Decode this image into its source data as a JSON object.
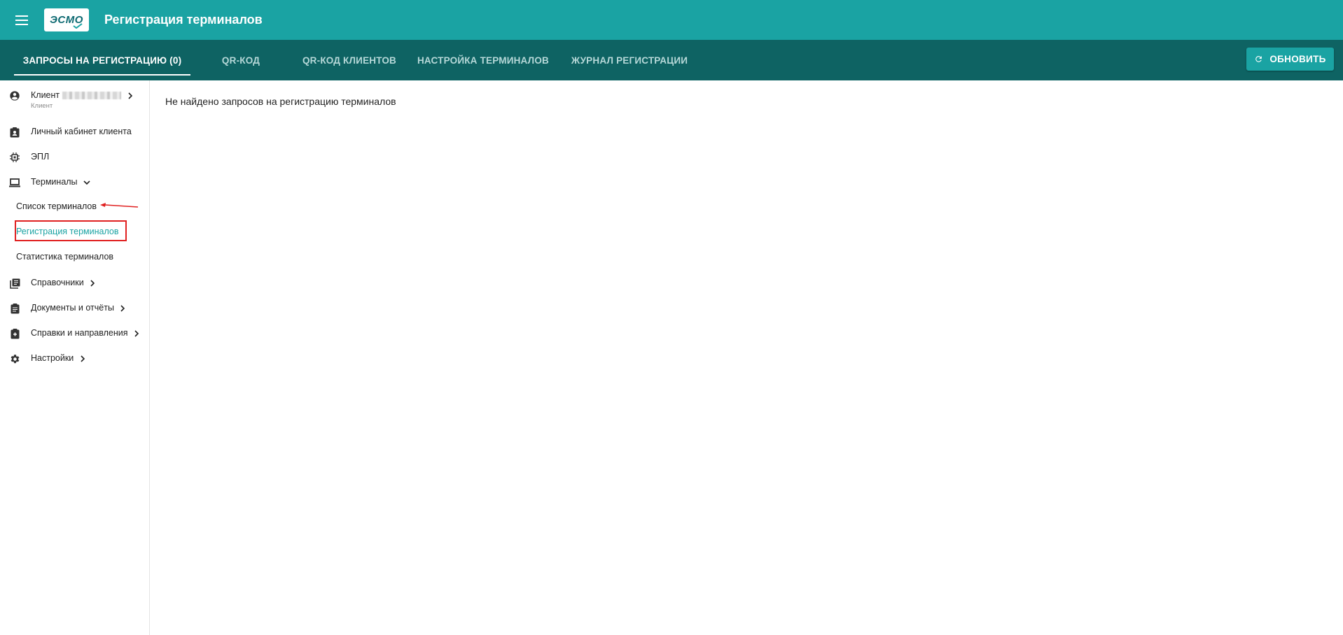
{
  "app": {
    "logo_text": "ЭСМО",
    "title": "Регистрация терминалов"
  },
  "tabs": [
    {
      "label": "ЗАПРОСЫ НА РЕГИСТРАЦИЮ (0)",
      "active": true
    },
    {
      "label": "QR-КОД",
      "active": false
    },
    {
      "label": "QR-КОД КЛИЕНТОВ",
      "active": false
    },
    {
      "label": "НАСТРОЙКА ТЕРМИНАЛОВ",
      "active": false
    },
    {
      "label": "ЖУРНАЛ РЕГИСТРАЦИИ",
      "active": false
    }
  ],
  "toolbar": {
    "refresh_label": "ОБНОВИТЬ"
  },
  "user": {
    "name": "Клиент",
    "role": "Клиент"
  },
  "sidebar": {
    "items": [
      {
        "label": "Личный кабинет клиента",
        "icon": "contact-card-icon"
      },
      {
        "label": "ЭПЛ",
        "icon": "chip-icon"
      },
      {
        "label": "Терминалы",
        "icon": "laptop-icon",
        "expanded": true
      },
      {
        "label": "Справочники",
        "icon": "library-books-icon"
      },
      {
        "label": "Документы и отчёты",
        "icon": "clipboard-icon"
      },
      {
        "label": "Справки и направления",
        "icon": "medical-clipboard-icon"
      },
      {
        "label": "Настройки",
        "icon": "gear-icon"
      }
    ],
    "terminals_sub": [
      {
        "label": "Список терминалов",
        "active": false
      },
      {
        "label": "Регистрация терминалов",
        "active": true
      },
      {
        "label": "Статистика терминалов",
        "active": false
      }
    ]
  },
  "main": {
    "empty_message": "Не найдено запросов на регистрацию терминалов"
  },
  "colors": {
    "primary": "#1aa3a3",
    "tabbar": "#0e6363",
    "annotation": "#e02020"
  }
}
